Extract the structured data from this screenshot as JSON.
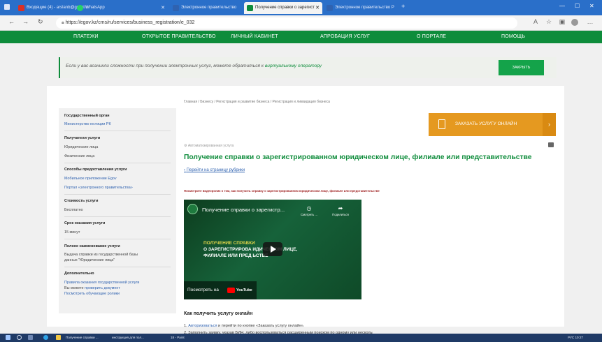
{
  "browser": {
    "tabs": [
      {
        "label": "Входящие (4) - arslanb@gmail.c",
        "icon_color": "#d93025"
      },
      {
        "label": "WhatsApp",
        "icon_color": "#25d366"
      },
      {
        "label": "Электронное правительство",
        "icon_color": "#2f62b0"
      },
      {
        "label": "Получение справки о зарегист",
        "icon_color": "#0e8c3b"
      },
      {
        "label": "Электронное правительство Р",
        "icon_color": "#2f62b0"
      }
    ],
    "new_tab_symbol": "+",
    "url": "https://egov.kz/cms/ru/services/business_registration/e_032"
  },
  "nav": {
    "items": [
      "ПЛАТЕЖИ",
      "ОТКРЫТОЕ ПРАВИТЕЛЬСТВО",
      "ЛИЧНЫЙ КАБИНЕТ",
      "АПРОБАЦИЯ УСЛУГ",
      "О ПОРТАЛЕ",
      "ПОМОЩЬ"
    ]
  },
  "notice": {
    "text": "Если у вас возникли сложности при получении электронных услуг, можете обратиться к ",
    "link": "виртуальному оператору",
    "close_label": "ЗАКРЫТЬ"
  },
  "sidebar": {
    "gov_body_title": "Государственный орган",
    "gov_body_value": "Министерство юстиции РК",
    "recipients_title": "Получатели услуги",
    "recipients": [
      "Юридические лица",
      "Физические лица"
    ],
    "methods_title": "Способы предоставления услуги",
    "methods": [
      "Мобильное приложение Egov",
      "Портал «электронного правительства»"
    ],
    "cost_title": "Стоимость услуги",
    "cost_value": "Бесплатно",
    "term_title": "Срок оказания услуги",
    "term_value": "15 минут",
    "fullname_title": "Полное наименование услуги",
    "fullname_line1": "Выдача справки из государственной базы",
    "fullname_line2": "данных \"Юридические лица\"",
    "extra_title": "Дополнительно",
    "extra_link1": "Правила оказания государственной услуги",
    "extra_text2_prefix": "Вы можете ",
    "extra_link2": "проверить документ",
    "extra_link3": "Посмотреть обучающие ролики"
  },
  "content": {
    "breadcrumb": "Главная / Бизнесу / Регистрация и развитие бизнеса / Регистрация и ликвидация бизнеса",
    "order_label": "ЗАКАЗАТЬ УСЛУГУ ОНЛАЙН",
    "order_arrow": "›",
    "auto_label": "Автоматизированная услуга",
    "title": "Получение справки о зарегистрированном юридическом лице, филиале или представительстве",
    "back_link": "Перейти на страницу рубрики",
    "video_caption": "Посмотрите видеоролик о том, как получить справку о зарегистрированном юридическом лице, филиале или представительстве",
    "how_title": "Как получить услугу онлайн",
    "step1_prefix": "1. ",
    "step1_link": "Авторизоваться",
    "step1_text": " и перейти по кнопке «Заказать услугу онлайн».",
    "step2_text": "2. Заполнить заявку, указав БИН, либо воспользоваться расширенным поиском по одному или нескольким идентификационным параметрам"
  },
  "video": {
    "title": "Получение справки о зарегистр...",
    "watch_later": "Смотреть ...",
    "share": "Поделиться",
    "line1": "ПОЛУЧЕНИЕ СПРАВКИ",
    "line2": "О ЗАРЕГИСТРИРОВА        ИДИЧЕСКОМ ЛИЦЕ,",
    "line3": "ФИЛИАЛЕ ИЛИ ПРЕД        ЬСТВЕ",
    "watch_on": "Посмотреть на",
    "youtube": "YouTube"
  },
  "taskbar": {
    "items": [
      "Получение справки ...",
      "инструкция для пол...",
      "18 - Paint"
    ],
    "clock": "РУС  10:27"
  },
  "colors": {
    "brand_green": "#0e8c3b",
    "order_orange": "#e59920",
    "link_blue": "#2f62b0"
  }
}
